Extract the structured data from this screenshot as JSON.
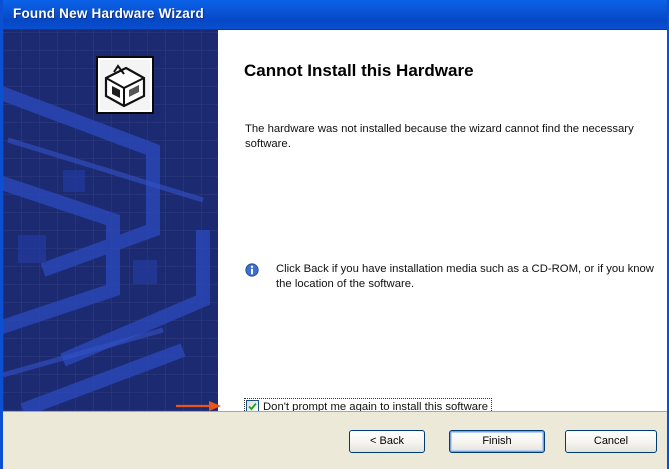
{
  "window": {
    "title": "Found New Hardware Wizard"
  },
  "sidebar": {
    "icon": "hardware-wizard-icon"
  },
  "main": {
    "heading": "Cannot Install this Hardware",
    "message": "The hardware was not installed because the wizard cannot find the necessary software.",
    "info_icon": "info-icon",
    "info_text": "Click Back if you have installation media such as a CD-ROM, or if you know the location of the software.",
    "checkbox": {
      "label": "Don't prompt me again to install this software",
      "checked": true
    }
  },
  "annotation": {
    "arrow_color": "#e8551c"
  },
  "buttons": {
    "back_label": "< Back",
    "finish_label": "Finish",
    "cancel_label": "Cancel"
  },
  "colors": {
    "titlebar": "#0a55d8",
    "sidebar": "#1c2b71",
    "button_face": "#ece9d8"
  }
}
